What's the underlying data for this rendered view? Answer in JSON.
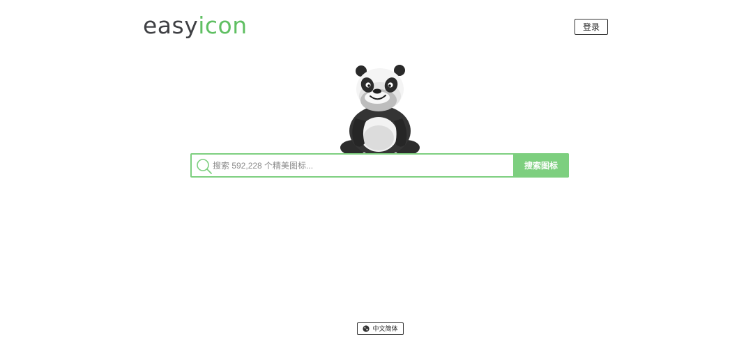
{
  "header": {
    "logo": {
      "part1": "easy",
      "part2": "icon"
    },
    "login_label": "登录"
  },
  "search": {
    "placeholder": "搜索 592,228 个精美图标...",
    "value": "",
    "button_label": "搜索图标"
  },
  "footer": {
    "language_label": "中文简体"
  },
  "colors": {
    "accent": "#7dcf7f",
    "logo_dark": "#3f4044",
    "logo_green": "#5fbf62"
  },
  "icons": {
    "search": "magnifier-icon",
    "language": "globe-icon",
    "mascot": "panda-mascot"
  }
}
